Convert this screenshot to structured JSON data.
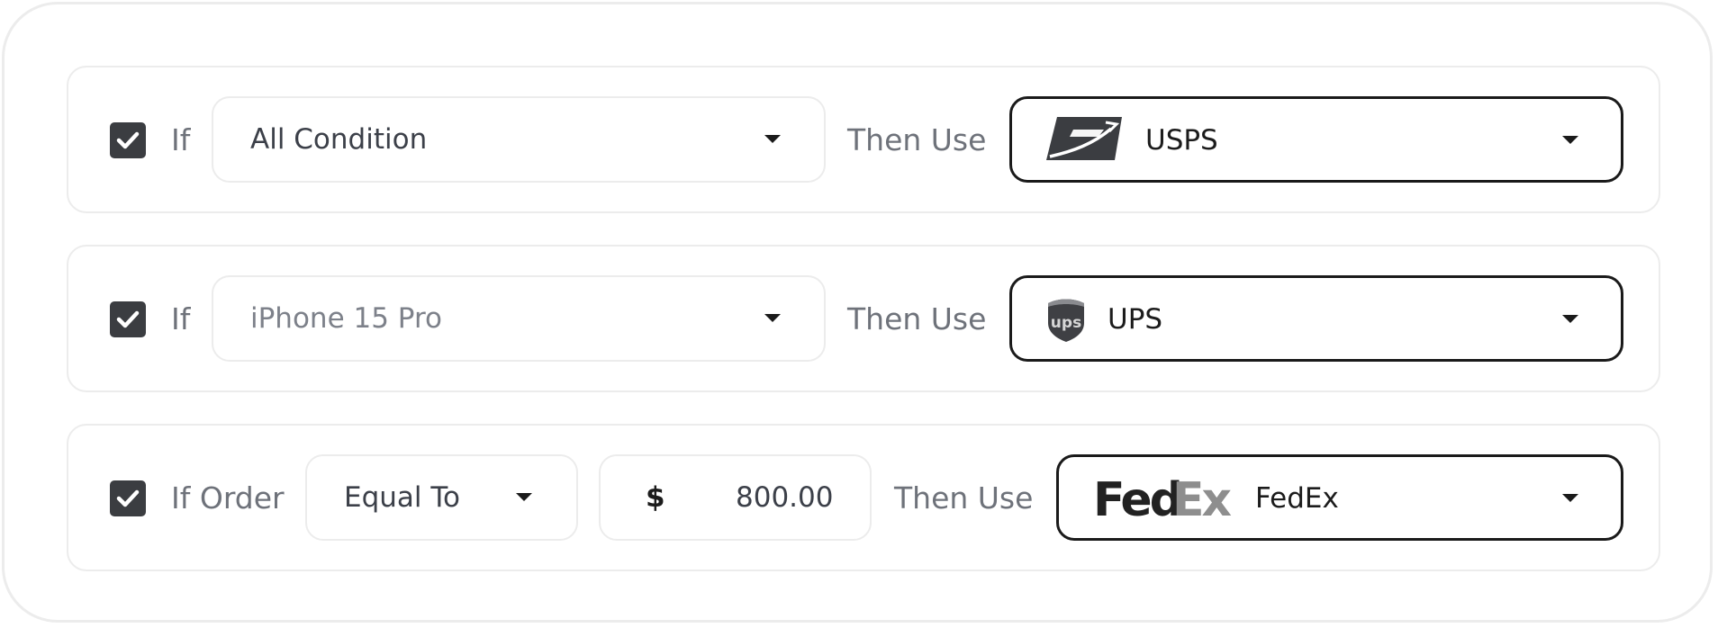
{
  "rules": [
    {
      "checked": true,
      "if_label": "If",
      "condition": {
        "value": "All Condition"
      },
      "then_label": "Then Use",
      "carrier": {
        "value": "USPS",
        "icon": "usps-logo-icon"
      }
    },
    {
      "checked": true,
      "if_label": "If",
      "condition": {
        "placeholder": "iPhone 15 Pro"
      },
      "then_label": "Then Use",
      "carrier": {
        "value": "UPS",
        "icon": "ups-logo-icon",
        "logo_text": "ups"
      }
    },
    {
      "checked": true,
      "if_label": "If Order",
      "operator": {
        "value": "Equal To"
      },
      "amount": {
        "currency": "$",
        "value": "800.00"
      },
      "then_label": "Then Use",
      "carrier": {
        "value": "FedEx",
        "icon": "fedex-logo-icon",
        "logo_text_fed": "Fed",
        "logo_text_ex": "Ex"
      }
    }
  ],
  "colors": {
    "checkbox": "#3b3d41",
    "label_text": "#6e727a",
    "border_light": "#ececec",
    "border_dark": "#1a1a1a"
  }
}
